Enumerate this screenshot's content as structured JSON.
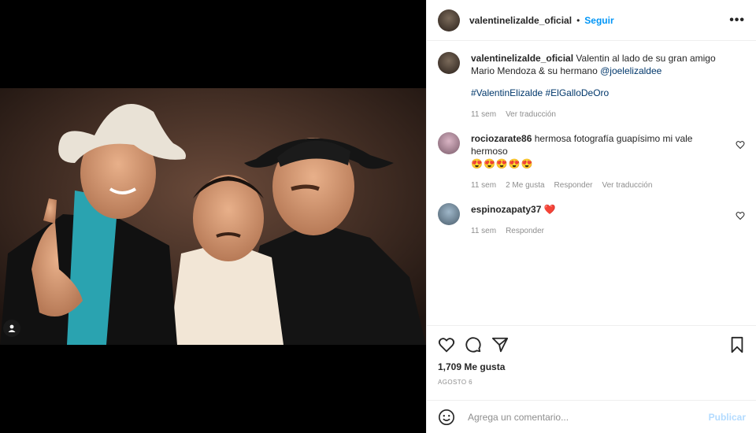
{
  "post": {
    "author": "valentinelizalde_oficial",
    "follow_label": "Seguir",
    "dot": "•",
    "more": "•••"
  },
  "caption": {
    "username": "valentinelizalde_oficial",
    "text": "Valentin al lado de su gran amigo Mario Mendoza & su hermano ",
    "mention": "@joelelizaldee",
    "hashtags": "#ValentinElizalde #ElGalloDeOro",
    "time": "11 sem",
    "translate": "Ver traducción"
  },
  "comments": [
    {
      "username": "rociozarate86",
      "text": "hermosa fotografía guapísimo mi vale hermoso",
      "emojis": "😍😍😍😍😍",
      "time": "11 sem",
      "likes": "2 Me gusta",
      "reply": "Responder",
      "translate": "Ver traducción"
    },
    {
      "username": "espinozapaty37",
      "heart": "❤️",
      "time": "11 sem",
      "reply": "Responder"
    }
  ],
  "stats": {
    "likes": "1,709 Me gusta",
    "date": "AGOSTO 6"
  },
  "comment_box": {
    "placeholder": "Agrega un comentario...",
    "publish": "Publicar"
  },
  "colors": {
    "accent": "#0095f6",
    "link": "#00376b",
    "muted": "#8e8e8e",
    "publish_disabled": "#b3dbff"
  }
}
